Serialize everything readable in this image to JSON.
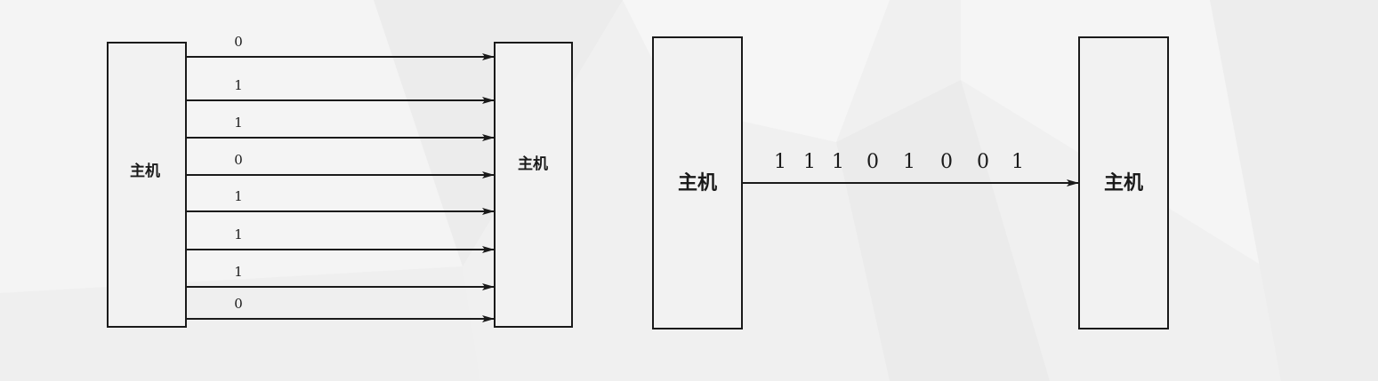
{
  "parallel": {
    "sender_label": "主机",
    "receiver_label": "主机",
    "bits": [
      "0",
      "1",
      "1",
      "0",
      "1",
      "1",
      "1",
      "0"
    ]
  },
  "serial": {
    "sender_label": "主机",
    "receiver_label": "主机",
    "bits": [
      "1",
      "1",
      "1",
      "0",
      "1",
      "0",
      "0",
      "1"
    ]
  }
}
